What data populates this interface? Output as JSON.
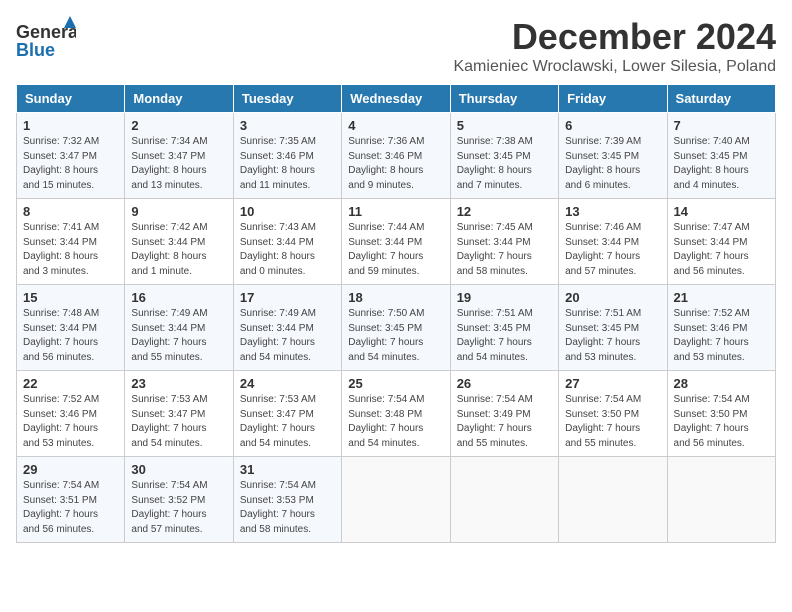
{
  "header": {
    "logo_line1": "General",
    "logo_line2": "Blue",
    "month_title": "December 2024",
    "location": "Kamieniec Wroclawski, Lower Silesia, Poland"
  },
  "weekdays": [
    "Sunday",
    "Monday",
    "Tuesday",
    "Wednesday",
    "Thursday",
    "Friday",
    "Saturday"
  ],
  "weeks": [
    [
      {
        "day": "1",
        "info": "Sunrise: 7:32 AM\nSunset: 3:47 PM\nDaylight: 8 hours\nand 15 minutes."
      },
      {
        "day": "2",
        "info": "Sunrise: 7:34 AM\nSunset: 3:47 PM\nDaylight: 8 hours\nand 13 minutes."
      },
      {
        "day": "3",
        "info": "Sunrise: 7:35 AM\nSunset: 3:46 PM\nDaylight: 8 hours\nand 11 minutes."
      },
      {
        "day": "4",
        "info": "Sunrise: 7:36 AM\nSunset: 3:46 PM\nDaylight: 8 hours\nand 9 minutes."
      },
      {
        "day": "5",
        "info": "Sunrise: 7:38 AM\nSunset: 3:45 PM\nDaylight: 8 hours\nand 7 minutes."
      },
      {
        "day": "6",
        "info": "Sunrise: 7:39 AM\nSunset: 3:45 PM\nDaylight: 8 hours\nand 6 minutes."
      },
      {
        "day": "7",
        "info": "Sunrise: 7:40 AM\nSunset: 3:45 PM\nDaylight: 8 hours\nand 4 minutes."
      }
    ],
    [
      {
        "day": "8",
        "info": "Sunrise: 7:41 AM\nSunset: 3:44 PM\nDaylight: 8 hours\nand 3 minutes."
      },
      {
        "day": "9",
        "info": "Sunrise: 7:42 AM\nSunset: 3:44 PM\nDaylight: 8 hours\nand 1 minute."
      },
      {
        "day": "10",
        "info": "Sunrise: 7:43 AM\nSunset: 3:44 PM\nDaylight: 8 hours\nand 0 minutes."
      },
      {
        "day": "11",
        "info": "Sunrise: 7:44 AM\nSunset: 3:44 PM\nDaylight: 7 hours\nand 59 minutes."
      },
      {
        "day": "12",
        "info": "Sunrise: 7:45 AM\nSunset: 3:44 PM\nDaylight: 7 hours\nand 58 minutes."
      },
      {
        "day": "13",
        "info": "Sunrise: 7:46 AM\nSunset: 3:44 PM\nDaylight: 7 hours\nand 57 minutes."
      },
      {
        "day": "14",
        "info": "Sunrise: 7:47 AM\nSunset: 3:44 PM\nDaylight: 7 hours\nand 56 minutes."
      }
    ],
    [
      {
        "day": "15",
        "info": "Sunrise: 7:48 AM\nSunset: 3:44 PM\nDaylight: 7 hours\nand 56 minutes."
      },
      {
        "day": "16",
        "info": "Sunrise: 7:49 AM\nSunset: 3:44 PM\nDaylight: 7 hours\nand 55 minutes."
      },
      {
        "day": "17",
        "info": "Sunrise: 7:49 AM\nSunset: 3:44 PM\nDaylight: 7 hours\nand 54 minutes."
      },
      {
        "day": "18",
        "info": "Sunrise: 7:50 AM\nSunset: 3:45 PM\nDaylight: 7 hours\nand 54 minutes."
      },
      {
        "day": "19",
        "info": "Sunrise: 7:51 AM\nSunset: 3:45 PM\nDaylight: 7 hours\nand 54 minutes."
      },
      {
        "day": "20",
        "info": "Sunrise: 7:51 AM\nSunset: 3:45 PM\nDaylight: 7 hours\nand 53 minutes."
      },
      {
        "day": "21",
        "info": "Sunrise: 7:52 AM\nSunset: 3:46 PM\nDaylight: 7 hours\nand 53 minutes."
      }
    ],
    [
      {
        "day": "22",
        "info": "Sunrise: 7:52 AM\nSunset: 3:46 PM\nDaylight: 7 hours\nand 53 minutes."
      },
      {
        "day": "23",
        "info": "Sunrise: 7:53 AM\nSunset: 3:47 PM\nDaylight: 7 hours\nand 54 minutes."
      },
      {
        "day": "24",
        "info": "Sunrise: 7:53 AM\nSunset: 3:47 PM\nDaylight: 7 hours\nand 54 minutes."
      },
      {
        "day": "25",
        "info": "Sunrise: 7:54 AM\nSunset: 3:48 PM\nDaylight: 7 hours\nand 54 minutes."
      },
      {
        "day": "26",
        "info": "Sunrise: 7:54 AM\nSunset: 3:49 PM\nDaylight: 7 hours\nand 55 minutes."
      },
      {
        "day": "27",
        "info": "Sunrise: 7:54 AM\nSunset: 3:50 PM\nDaylight: 7 hours\nand 55 minutes."
      },
      {
        "day": "28",
        "info": "Sunrise: 7:54 AM\nSunset: 3:50 PM\nDaylight: 7 hours\nand 56 minutes."
      }
    ],
    [
      {
        "day": "29",
        "info": "Sunrise: 7:54 AM\nSunset: 3:51 PM\nDaylight: 7 hours\nand 56 minutes."
      },
      {
        "day": "30",
        "info": "Sunrise: 7:54 AM\nSunset: 3:52 PM\nDaylight: 7 hours\nand 57 minutes."
      },
      {
        "day": "31",
        "info": "Sunrise: 7:54 AM\nSunset: 3:53 PM\nDaylight: 7 hours\nand 58 minutes."
      },
      null,
      null,
      null,
      null
    ]
  ]
}
